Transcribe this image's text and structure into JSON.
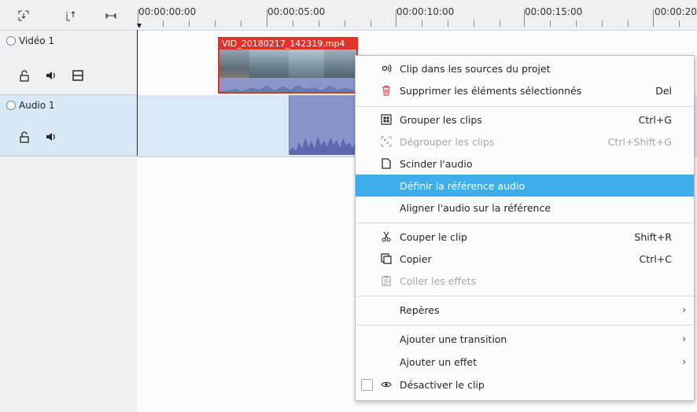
{
  "ruler": {
    "timecodes": [
      "00:00:00:00",
      "00:00:05:00",
      "00:00:10:00",
      "00:00:15:00",
      "00:00:20"
    ]
  },
  "tracks": {
    "video": {
      "name": "Vidéo 1"
    },
    "audio": {
      "name": "Audio 1"
    }
  },
  "clips": {
    "video_clip": {
      "title": "VID_20180217_142319.mp4"
    }
  },
  "context_menu": {
    "items": [
      {
        "label": "Clip dans les sources du projet",
        "shortcut": "",
        "icon": "clip-source-icon",
        "state": "normal"
      },
      {
        "label": "Supprimer les éléments sélectionnés",
        "shortcut": "Del",
        "icon": "delete-icon",
        "state": "normal"
      },
      {
        "label": "Grouper les clips",
        "shortcut": "Ctrl+G",
        "icon": "group-icon",
        "state": "normal"
      },
      {
        "label": "Dégrouper les clips",
        "shortcut": "Ctrl+Shift+G",
        "icon": "ungroup-icon",
        "state": "disabled"
      },
      {
        "label": "Scinder l'audio",
        "shortcut": "",
        "icon": "split-audio-icon",
        "state": "normal"
      },
      {
        "label": "Définir la référence audio",
        "shortcut": "",
        "icon": "",
        "state": "highlighted"
      },
      {
        "label": "Aligner l'audio sur la référence",
        "shortcut": "",
        "icon": "",
        "state": "normal"
      },
      {
        "label": "Couper le clip",
        "shortcut": "Shift+R",
        "icon": "scissors-icon",
        "state": "normal"
      },
      {
        "label": "Copier",
        "shortcut": "Ctrl+C",
        "icon": "copy-icon",
        "state": "normal"
      },
      {
        "label": "Coller les effets",
        "shortcut": "",
        "icon": "paste-icon",
        "state": "disabled"
      },
      {
        "label": "Repères",
        "shortcut": "",
        "icon": "",
        "state": "submenu"
      },
      {
        "label": "Ajouter une transition",
        "shortcut": "",
        "icon": "",
        "state": "submenu"
      },
      {
        "label": "Ajouter un effet",
        "shortcut": "",
        "icon": "",
        "state": "submenu"
      },
      {
        "label": "Désactiver le clip",
        "shortcut": "",
        "icon": "eye-icon",
        "state": "checkbox"
      }
    ],
    "submenu_arrow": "›"
  },
  "colors": {
    "highlight": "#3daee9",
    "selected_clip": "#e0342b",
    "audio_track_bg": "#dbe8f5",
    "waveform": "#8a93cb"
  }
}
